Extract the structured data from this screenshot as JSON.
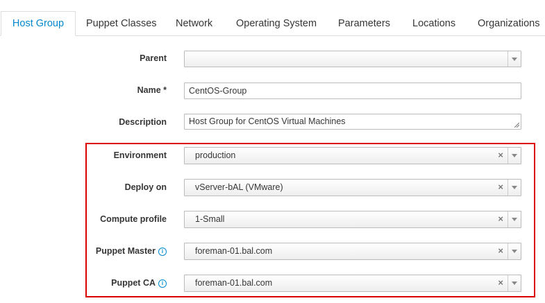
{
  "tabs": [
    {
      "label": "Host Group",
      "active": true
    },
    {
      "label": "Puppet Classes",
      "active": false
    },
    {
      "label": "Network",
      "active": false
    },
    {
      "label": "Operating System",
      "active": false
    },
    {
      "label": "Parameters",
      "active": false
    },
    {
      "label": "Locations",
      "active": false
    },
    {
      "label": "Organizations",
      "active": false
    }
  ],
  "form": {
    "parent": {
      "label": "Parent",
      "value": ""
    },
    "name": {
      "label": "Name *",
      "value": "CentOS-Group"
    },
    "description": {
      "label": "Description",
      "value": "Host Group for CentOS Virtual Machines"
    },
    "environment": {
      "label": "Environment",
      "value": "production"
    },
    "deploy_on": {
      "label": "Deploy on",
      "value": "vServer-bAL (VMware)"
    },
    "compute_profile": {
      "label": "Compute profile",
      "value": "1-Small"
    },
    "puppet_master": {
      "label": "Puppet Master",
      "value": "foreman-01.bal.com"
    },
    "puppet_ca": {
      "label": "Puppet CA",
      "value": "foreman-01.bal.com"
    }
  },
  "icons": {
    "clear": "×",
    "info": "i"
  },
  "colors": {
    "accent": "#0088ce",
    "highlight": "#dd0000"
  }
}
